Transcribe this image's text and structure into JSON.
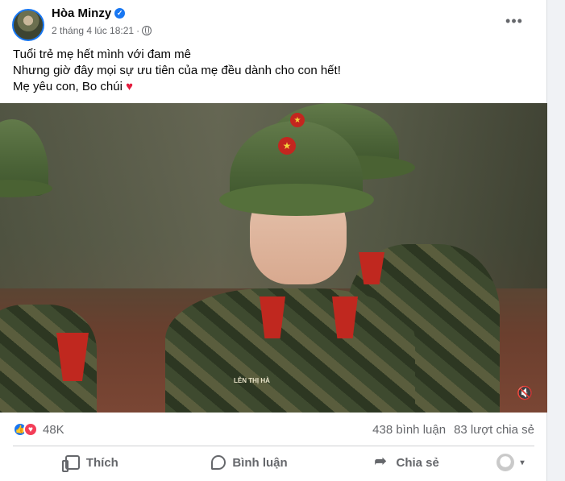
{
  "post": {
    "author": "Hòa Minzy",
    "timestamp": "2 tháng 4 lúc 18:21",
    "dot": "·",
    "more_label": "•••",
    "caption": {
      "line1": "Tuổi trẻ mẹ hết mình với đam mê",
      "line2": "Nhưng giờ đây mọi sự ưu tiên của mẹ đều dành cho con hết!",
      "line3": "Mẹ yêu con, Bo chúi",
      "line3_emoji": "♥"
    },
    "video": {
      "name_tag": "LÊN THỊ HÀ",
      "mute_icon": "🔇"
    }
  },
  "stats": {
    "reactions": [
      "like",
      "love"
    ],
    "reaction_count": "48K",
    "comments": "438 bình luận",
    "shares": "83 lượt chia sẻ"
  },
  "actions": {
    "like": "Thích",
    "comment": "Bình luận",
    "share": "Chia sẻ",
    "caret": "▾"
  },
  "icons": {
    "verified": "✓",
    "like_reaction": "👍",
    "love_reaction": "♥"
  },
  "colors": {
    "brand_blue": "#1877f2",
    "love_red": "#f33e58",
    "secondary_text": "#65676b"
  }
}
